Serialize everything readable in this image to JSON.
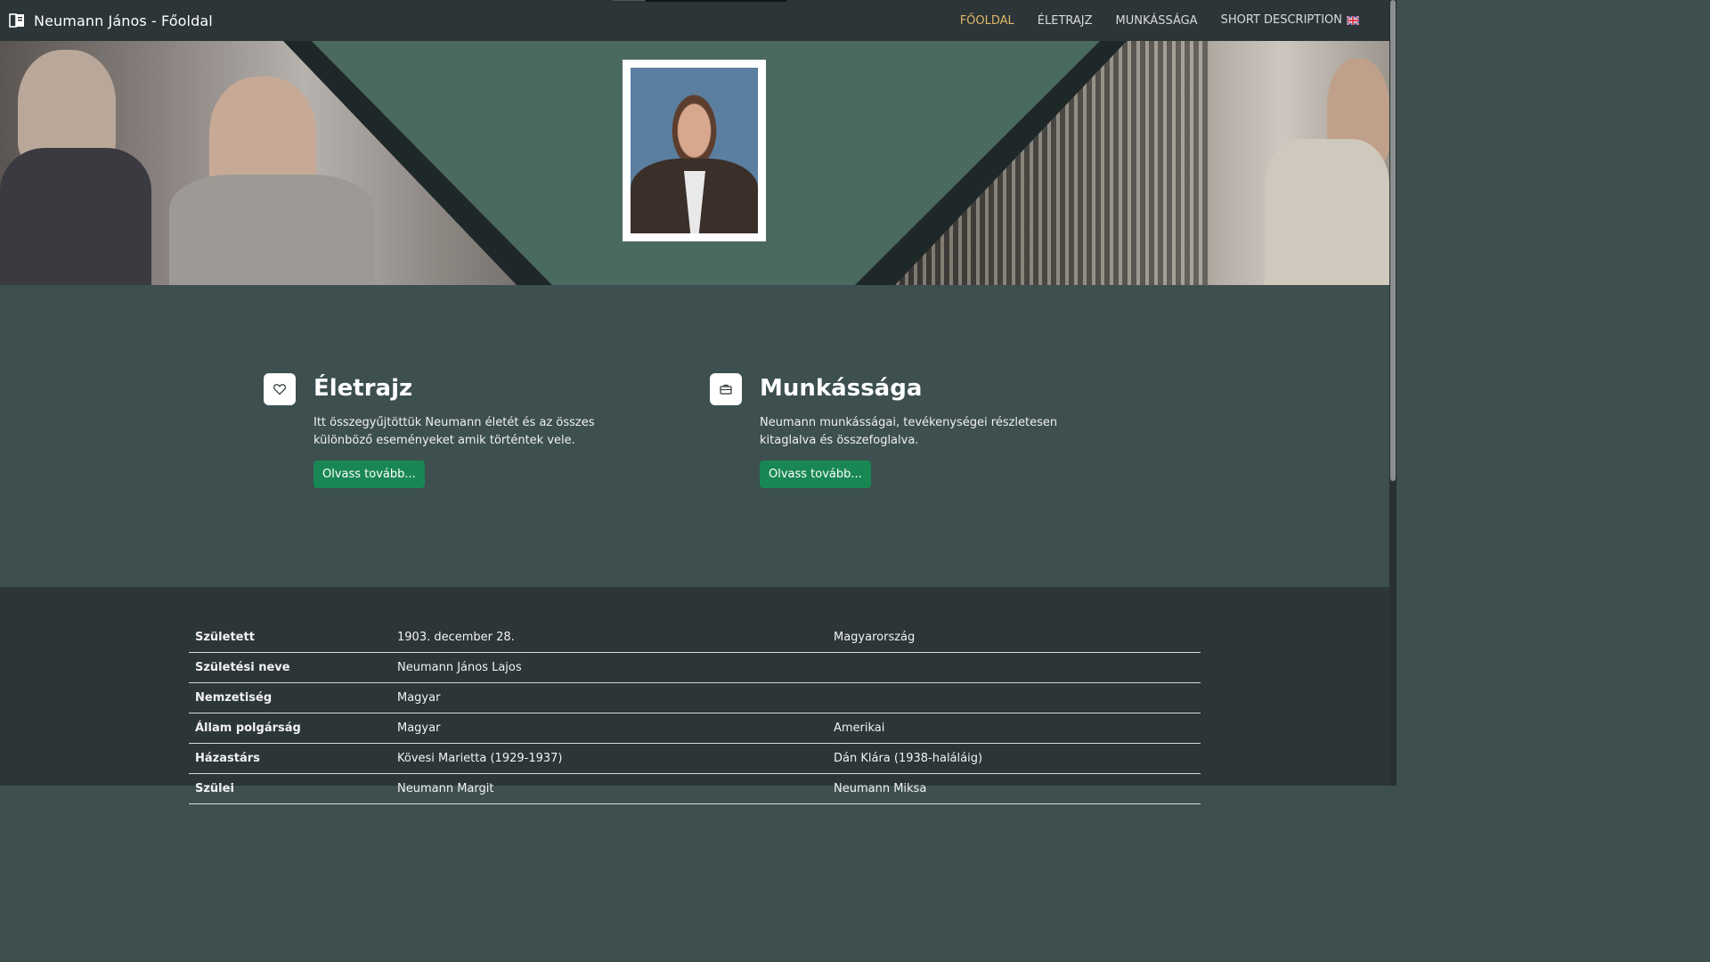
{
  "navbar": {
    "brand_icon": "book-icon",
    "title": "Neumann János - Főoldal",
    "links": [
      {
        "label": "FŐOLDAL",
        "active": true
      },
      {
        "label": "ÉLETRAJZ",
        "active": false
      },
      {
        "label": "MUNKÁSSÁGA",
        "active": false
      },
      {
        "label": "SHORT DESCRIPTION",
        "active": false,
        "icon": "uk-flag-icon"
      }
    ]
  },
  "colors": {
    "nav_bg": "#2c3537",
    "page_bg": "#3d4f4f",
    "hero_bg": "#4b6a5f",
    "accent_active": "#e0b76a",
    "button_green": "#198754"
  },
  "features": [
    {
      "icon": "heart-icon",
      "title": "Életrajz",
      "text": "Itt összegyűjtöttük Neumann életét és az összes különböző eseményeket amik történtek vele.",
      "button": "Olvass tovább..."
    },
    {
      "icon": "briefcase-icon",
      "title": "Munkássága",
      "text": "Neumann munkásságai, tevékenységei részletesen kitaglalva és összefoglalva.",
      "button": "Olvass tovább..."
    }
  ],
  "info_table": [
    {
      "label": "Született",
      "value": "1903. december 28.",
      "extra": "Magyarország"
    },
    {
      "label": "Születési neve",
      "value": "Neumann János Lajos",
      "extra": ""
    },
    {
      "label": "Nemzetiség",
      "value": "Magyar",
      "extra": ""
    },
    {
      "label": "Állam polgárság",
      "value": "Magyar",
      "extra": "Amerikai"
    },
    {
      "label": "Házastárs",
      "value": "Kövesi Marietta (1929-1937)",
      "extra": "Dán Klára (1938-haláláig)"
    },
    {
      "label": "Szülei",
      "value": "Neumann Margit",
      "extra": "Neumann Miksa"
    }
  ]
}
